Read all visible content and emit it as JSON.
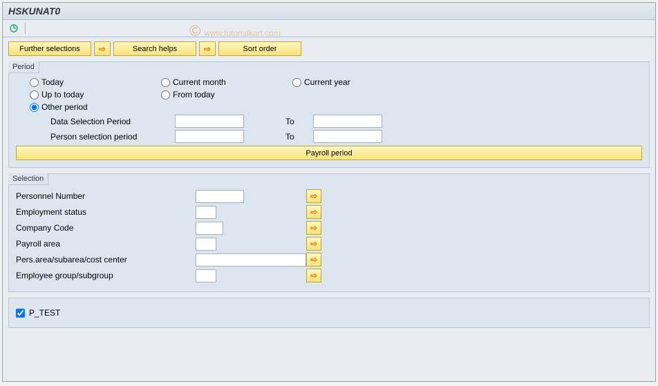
{
  "header": {
    "title": "HSKUNAT0"
  },
  "watermark": {
    "copy": "©",
    "text": "www.tutorialkart.com"
  },
  "buttons": {
    "further": "Further selections",
    "search": "Search helps",
    "sort": "Sort order"
  },
  "period": {
    "title": "Period",
    "today": "Today",
    "current_month": "Current month",
    "current_year": "Current year",
    "up_to_today": "Up to today",
    "from_today": "From today",
    "other": "Other period",
    "data_sel": "Data Selection Period",
    "person_sel": "Person selection period",
    "to": "To",
    "payroll": "Payroll period"
  },
  "selection": {
    "title": "Selection",
    "pernr": "Personnel Number",
    "empstat": "Employment status",
    "ccode": "Company Code",
    "parea": "Payroll area",
    "psacc": "Pers.area/subarea/cost center",
    "egroup": "Employee group/subgroup"
  },
  "bottom": {
    "ptest": "P_TEST",
    "checked": true
  }
}
